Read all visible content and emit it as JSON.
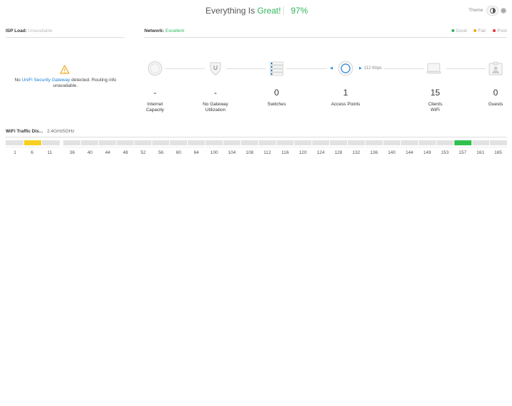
{
  "header": {
    "status_prefix": "Everything Is",
    "status_word": "Great!",
    "score": "97%",
    "theme_label": "Theme"
  },
  "isp": {
    "label": "ISP Load:",
    "value": "Unavailable",
    "msg_before": "No",
    "msg_link": "UniFi Security Gateway",
    "msg_after": "detected. Routing info unavailable."
  },
  "network": {
    "label": "Network:",
    "value": "Excellent",
    "legend": [
      {
        "label": "Good",
        "color": "#2fb55a"
      },
      {
        "label": "Fair",
        "color": "#f0a818"
      },
      {
        "label": "Poor",
        "color": "#e33"
      }
    ],
    "throughput": "112 Kbps",
    "nodes": [
      {
        "value": "-",
        "label1": "Internet",
        "label2": "Capacity",
        "icon": "globe-icon"
      },
      {
        "value": "-",
        "label1": "No Gateway",
        "label2": "Utilization",
        "icon": "gateway-shield-icon"
      },
      {
        "value": "0",
        "label1": "Switches",
        "label2": "",
        "icon": "switch-stack-icon"
      },
      {
        "value": "1",
        "label1": "Access Points",
        "label2": "",
        "icon": "access-point-icon"
      },
      {
        "value": "15",
        "label1": "Clients",
        "label2": "WiFi",
        "icon": "laptop-icon"
      },
      {
        "value": "0",
        "label1": "Guests",
        "label2": "",
        "icon": "guest-badge-icon"
      }
    ]
  },
  "wifi": {
    "title": "WiFi Traffic Dis...",
    "band24": "2.4GHz",
    "band5": "5GHz",
    "channels24": [
      "1",
      "6",
      "11"
    ],
    "channels5": [
      "36",
      "40",
      "44",
      "48",
      "52",
      "56",
      "60",
      "64",
      "100",
      "104",
      "108",
      "112",
      "116",
      "120",
      "124",
      "128",
      "132",
      "136",
      "140",
      "144",
      "149",
      "153",
      "157",
      "161",
      "165"
    ]
  }
}
